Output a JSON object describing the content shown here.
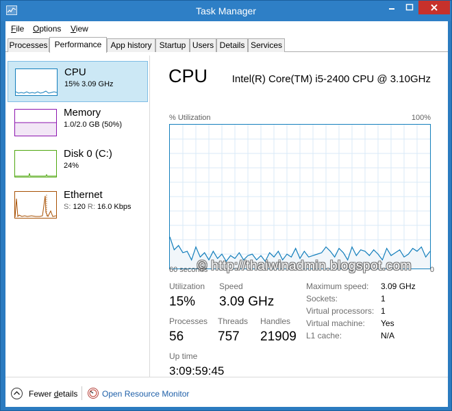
{
  "window": {
    "title": "Task Manager"
  },
  "menu": [
    {
      "label": "File",
      "underline": "F",
      "rest": "ile"
    },
    {
      "label": "Options",
      "underline": "O",
      "rest": "ptions"
    },
    {
      "label": "View",
      "underline": "V",
      "rest": "iew"
    }
  ],
  "tabs": [
    "Processes",
    "Performance",
    "App history",
    "Startup",
    "Users",
    "Details",
    "Services"
  ],
  "active_tab": "Performance",
  "sidebar": {
    "cpu": {
      "name": "CPU",
      "sub": "15%  3.09 GHz",
      "color": "#117dbb"
    },
    "memory": {
      "name": "Memory",
      "sub": "1.0/2.0 GB (50%)",
      "color": "#8b12ae"
    },
    "disk": {
      "name": "Disk 0 (C:)",
      "sub": "24%",
      "color": "#4da60c"
    },
    "ethernet": {
      "name": "Ethernet",
      "s_label": "S:",
      "s_val": "120",
      "r_label": "R:",
      "r_val": "16.0 Kbps",
      "color": "#a74f01"
    }
  },
  "main": {
    "title": "CPU",
    "model": "Intel(R) Core(TM) i5-2400 CPU @ 3.10GHz",
    "graph": {
      "y_label": "% Utilization",
      "y_max": "100%",
      "x_left": "60 seconds",
      "x_right": "0",
      "watermark": "© http://thaiwinadmin.blogspot.com",
      "utilization": [
        22,
        13,
        16,
        11,
        12,
        6,
        15,
        8,
        11,
        6,
        12,
        7,
        10,
        5,
        9,
        7,
        11,
        6,
        9,
        10,
        6,
        9,
        5,
        11,
        8,
        12,
        6,
        10,
        8,
        14,
        7,
        12,
        8,
        9,
        10,
        11,
        15,
        12,
        8,
        14,
        11,
        6,
        15,
        9,
        13,
        12,
        9,
        13,
        10,
        6,
        14,
        9,
        11,
        13,
        8,
        10,
        14,
        12,
        15,
        8,
        12
      ]
    },
    "stats": {
      "utilization_label": "Utilization",
      "utilization": "15%",
      "speed_label": "Speed",
      "speed": "3.09 GHz",
      "processes_label": "Processes",
      "processes": "56",
      "threads_label": "Threads",
      "threads": "757",
      "handles_label": "Handles",
      "handles": "21909",
      "uptime_label": "Up time",
      "uptime": "3:09:59:45"
    },
    "details": [
      {
        "key": "Maximum speed:",
        "value": "3.09 GHz"
      },
      {
        "key": "Sockets:",
        "value": "1"
      },
      {
        "key": "Virtual processors:",
        "value": "1"
      },
      {
        "key": "Virtual machine:",
        "value": "Yes"
      },
      {
        "key": "L1 cache:",
        "value": "N/A"
      }
    ]
  },
  "footer": {
    "fewer_details": "Fewer details",
    "fewer_underline": "d",
    "resource_monitor": "Open Resource Monitor"
  }
}
